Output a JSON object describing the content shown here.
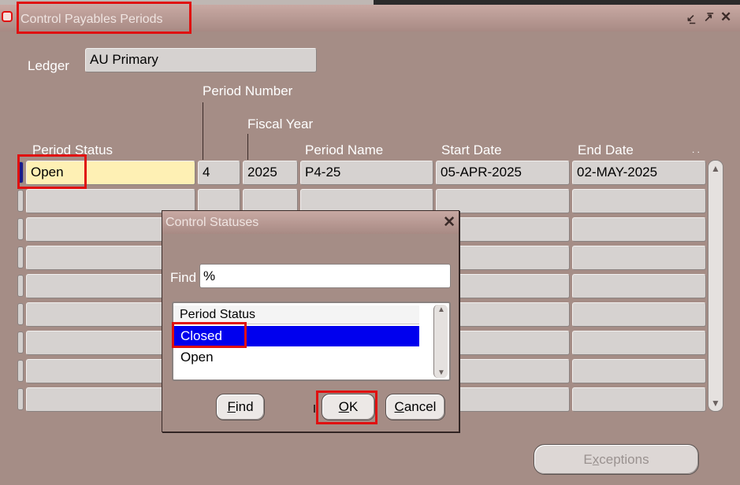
{
  "window": {
    "title": "Control Payables Periods",
    "controls": {
      "minimize": "⸙",
      "restore": "⇱",
      "close": "✕"
    }
  },
  "ledger": {
    "label": "Ledger",
    "value": "AU Primary"
  },
  "columns": {
    "period_number": "Period Number",
    "fiscal_year": "Fiscal Year",
    "period_status": "Period Status",
    "period_name": "Period Name",
    "start_date": "Start Date",
    "end_date": "End Date"
  },
  "row": {
    "status": "Open",
    "number": "4",
    "year": "2025",
    "name": "P4-25",
    "start": "05-APR-2025",
    "end": "02-MAY-2025"
  },
  "dialog": {
    "title": "Control Statuses",
    "find_label": "Find",
    "find_value": "%",
    "list_header": "Period Status",
    "options": [
      "Closed",
      "Open"
    ],
    "selected": "Closed",
    "buttons": {
      "find": "Find",
      "find_key": "F",
      "ok": "OK",
      "ok_key": "O",
      "cancel": "Cancel",
      "cancel_key": "C"
    }
  },
  "exceptions_button": {
    "label_pre": "E",
    "label_key": "x",
    "label_post": "ceptions"
  },
  "colors": {
    "highlight": "#e01010",
    "selection": "#0000ee",
    "current_field": "#fef0b4"
  }
}
